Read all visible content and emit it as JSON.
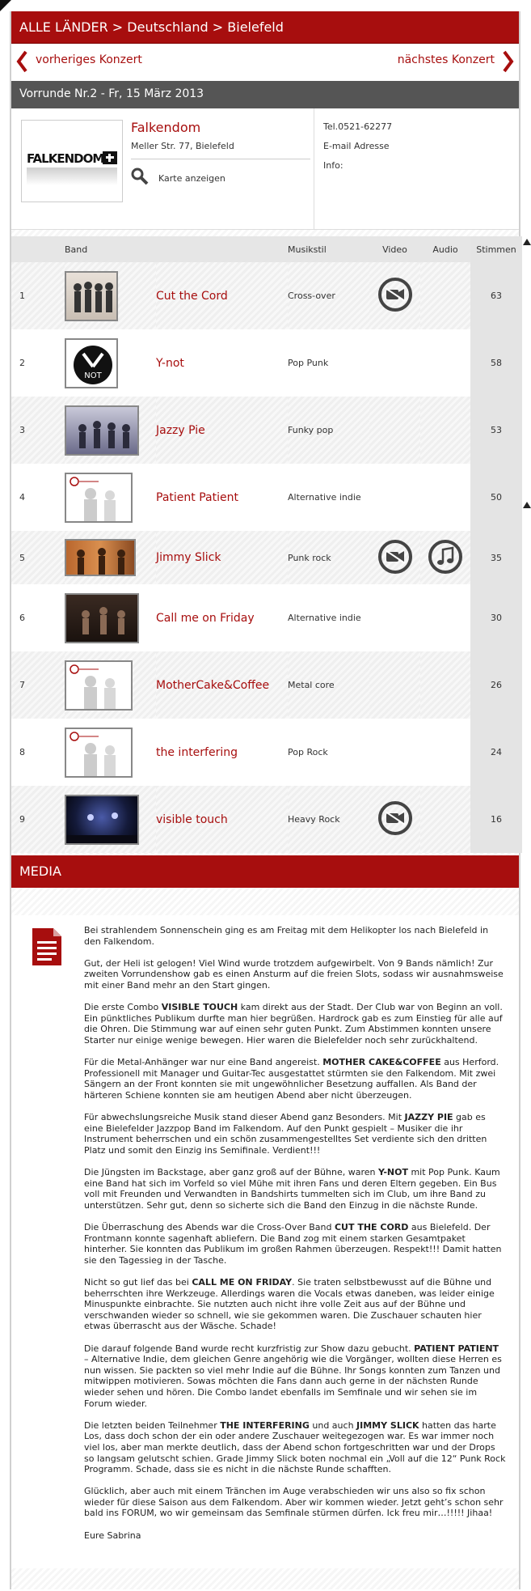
{
  "breadcrumb": "ALLE LÄNDER > Deutschland > Bielefeld",
  "nav": {
    "prev_label": "vorheriges Konzert",
    "next_label": "nächstes Konzert"
  },
  "round_title": "Vorrunde Nr.2 - Fr, 15 März 2013",
  "venue": {
    "logo_text": "FALKENDOM",
    "name": "Falkendom",
    "address": "Meller Str. 77, Bielefeld",
    "map_label": "Karte anzeigen",
    "tel": "Tel.0521-62277",
    "email": "E-mail Adresse",
    "info": "Info:"
  },
  "table": {
    "headers": {
      "band": "Band",
      "style": "Musikstil",
      "video": "Video",
      "audio": "Audio",
      "votes": "Stimmen"
    },
    "rows": [
      {
        "rank": "1",
        "name": "Cut the Cord",
        "style": "Cross-over",
        "votes": "63",
        "video": true,
        "audio": false
      },
      {
        "rank": "2",
        "name": "Y-not",
        "style": "Pop Punk",
        "votes": "58",
        "video": false,
        "audio": false
      },
      {
        "rank": "3",
        "name": "Jazzy Pie",
        "style": "Funky pop",
        "votes": "53",
        "video": false,
        "audio": false
      },
      {
        "rank": "4",
        "name": "Patient Patient",
        "style": "Alternative indie",
        "votes": "50",
        "video": false,
        "audio": false
      },
      {
        "rank": "5",
        "name": "Jimmy Slick",
        "style": "Punk rock",
        "votes": "35",
        "video": true,
        "audio": true
      },
      {
        "rank": "6",
        "name": "Call me on Friday",
        "style": "Alternative indie",
        "votes": "30",
        "video": false,
        "audio": false
      },
      {
        "rank": "7",
        "name": "MotherCake&Coffee",
        "style": "Metal core",
        "votes": "26",
        "video": false,
        "audio": false
      },
      {
        "rank": "8",
        "name": "the interfering",
        "style": "Pop Rock",
        "votes": "24",
        "video": false,
        "audio": false
      },
      {
        "rank": "9",
        "name": "visible touch",
        "style": "Heavy Rock",
        "votes": "16",
        "video": true,
        "audio": false
      }
    ]
  },
  "media_title": "MEDIA",
  "article": {
    "p1": "Bei strahlendem Sonnenschein ging es am Freitag mit dem Helikopter los nach Bielefeld in den Falkendom.",
    "p2": "Gut, der Heli ist gelogen! Viel Wind wurde trotzdem aufgewirbelt. Von 9 Bands nämlich! Zur zweiten Vorrundenshow gab es einen Ansturm auf die freien Slots, sodass wir ausnahmsweise mit einer Band mehr an den Start gingen.",
    "p3a": "Die erste Combo ",
    "p3b": "VISIBLE TOUCH",
    "p3c": " kam direkt aus der Stadt. Der Club war von Beginn an voll. Ein pünktliches Publikum durfte man hier begrüßen. Hardrock gab es zum Einstieg für alle auf die Ohren. Die Stimmung war auf einen sehr guten Punkt. Zum Abstimmen konnten unsere Starter nur einige wenige bewegen. Hier waren die Bielefelder noch sehr zurückhaltend.",
    "p4a": "Für die Metal-Anhänger war nur eine Band angereist. ",
    "p4b": "MOTHER CAKE&COFFEE",
    "p4c": " aus Herford. Professionell mit Manager und Guitar-Tec ausgestattet stürmten sie den Falkendom. Mit zwei Sängern an der Front konnten sie mit ungewöhnlicher Besetzung auffallen. Als Band der härteren Schiene konnten sie am heutigen Abend aber nicht überzeugen.",
    "p5a": "Für abwechslungsreiche Musik stand dieser Abend ganz Besonders. Mit ",
    "p5b": "JAZZY PIE",
    "p5c": "  gab es eine Bielefelder Jazzpop Band im Falkendom. Auf den Punkt gespielt – Musiker die ihr Instrument beherrschen und ein schön zusammengestelltes Set verdiente sich den dritten Platz und somit den Einzig ins Semifinale. Verdient!!!",
    "p6a": "Die Jüngsten im Backstage, aber ganz groß auf der Bühne, waren ",
    "p6b": "Y-NOT",
    "p6c": " mit Pop Punk. Kaum eine Band hat sich im Vorfeld so viel Mühe mit ihren Fans und deren Eltern gegeben. Ein Bus voll mit Freunden und Verwandten in Bandshirts tummelten sich im Club, um ihre Band zu unterstützen. Sehr gut, denn so sicherte sich die Band den Einzug in die nächste Runde.",
    "p7a": "Die Überraschung des Abends war die Cross-Over Band ",
    "p7b": "CUT THE CORD",
    "p7c": " aus Bielefeld. Der Frontmann konnte sagenhaft abliefern. Die Band zog mit einem starken Gesamtpaket hinterher. Sie konnten das Publikum im großen Rahmen überzeugen. Respekt!!! Damit hatten sie den Tagessieg in der Tasche.",
    "p8a": "Nicht so gut lief das bei ",
    "p8b": "CALL ME ON FRIDAY",
    "p8c": ". Sie traten selbstbewusst auf die Bühne und beherrschten ihre Werkzeuge. Allerdings waren die Vocals etwas daneben, was leider einige Minuspunkte einbrachte. Sie nutzten auch nicht ihre volle Zeit aus auf der Bühne und verschwanden wieder so schnell, wie sie gekommen waren. Die Zuschauer schauten hier etwas überrascht aus der Wäsche. Schade!",
    "p9a": "Die darauf folgende Band wurde recht kurzfristig zur Show dazu gebucht. ",
    "p9b": "PATIENT PATIENT",
    "p9c": " – Alternative Indie, dem gleichen Genre angehörig wie die Vorgänger, wollten diese Herren es nun wissen. Sie packten so viel mehr Indie auf die Bühne. Ihr Songs konnten zum Tanzen und mitwippen motivieren. Sowas möchten die Fans dann auch gerne in der nächsten Runde wieder sehen und hören. Die Combo landet ebenfalls im Semfinale und wir sehen sie im Forum wieder.",
    "p10a": "Die letzten beiden Teilnehmer ",
    "p10b": "THE INTERFERING",
    "p10c": " und auch ",
    "p10d": "JIMMY SLICK",
    "p10e": " hatten das harte Los, dass doch schon der ein oder andere Zuschauer weitegezogen war. Es war immer noch viel los, aber man merkte deutlich, dass der Abend schon fortgeschritten war und der Drops so langsam gelutscht schien. Grade Jimmy Slick boten nochmal ein „Voll auf die 12“ Punk Rock Programm. Schade, dass sie es nicht in die nächste Runde schafften.",
    "p11": "Glücklich, aber auch mit einem Tränchen im Auge verabschieden wir uns also so fix schon wieder für diese Saison aus dem Falkendom. Aber wir kommen wieder. Jetzt geht’s schon sehr bald ins FORUM, wo wir gemeinsam das Semfinale stürmen dürfen. Ick freu mir…!!!!! Jihaa!",
    "p12": "Eure Sabrina"
  },
  "colors": {
    "brand_red": "#a70e0e",
    "dark_bar": "#555555"
  }
}
